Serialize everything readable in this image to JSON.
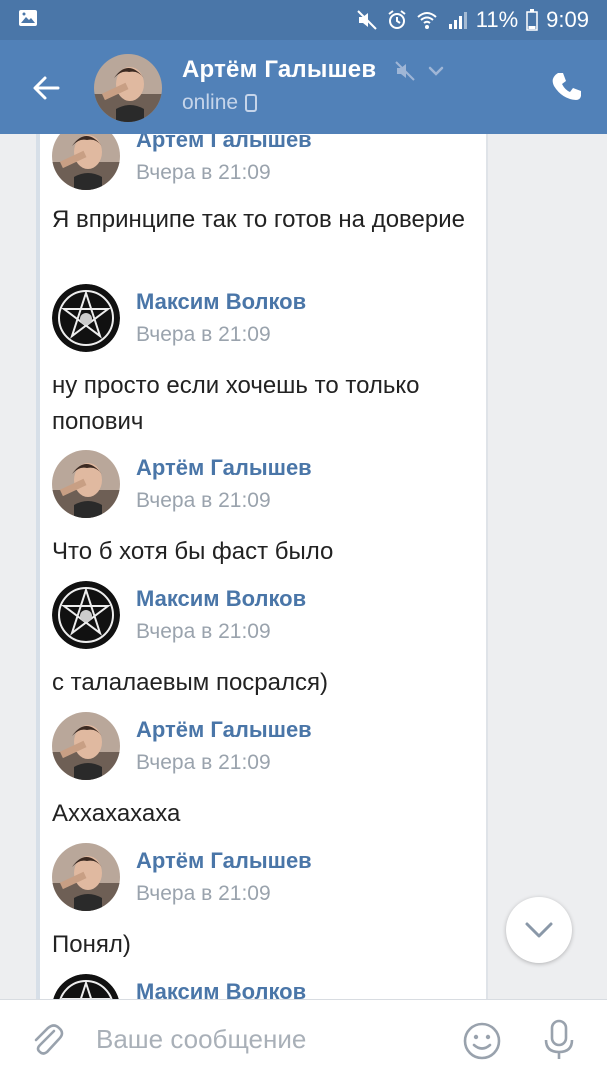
{
  "status_bar": {
    "battery": "11%",
    "time": "9:09"
  },
  "header": {
    "contact_name": "Артём Галышев",
    "status": "online"
  },
  "messages": [
    {
      "author": "Артём Галышев",
      "time": "Вчера в 21:09",
      "text": "Я впринципе так то готов на доверие",
      "avatar": "photo"
    },
    {
      "author": "Максим Волков",
      "time": "Вчера в 21:09",
      "text": "ну просто если хочешь то только попович",
      "avatar": "pentagram"
    },
    {
      "author": "Артём Галышев",
      "time": "Вчера в 21:09",
      "text": "Что б хотя бы фаст было",
      "avatar": "photo"
    },
    {
      "author": "Максим Волков",
      "time": "Вчера в 21:09",
      "text": "с талалаевым посрался)",
      "avatar": "pentagram"
    },
    {
      "author": "Артём Галышев",
      "time": "Вчера в 21:09",
      "text": "Аххахахаха",
      "avatar": "photo"
    },
    {
      "author": "Артём Галышев",
      "time": "Вчера в 21:09",
      "text": "Понял)",
      "avatar": "photo"
    },
    {
      "author": "Максим Волков",
      "time": "",
      "text": "",
      "avatar": "pentagram"
    }
  ],
  "composer": {
    "placeholder": "Ваше сообщение"
  },
  "icons": {
    "back": "arrow-left-icon",
    "mute": "mute-icon",
    "dropdown": "chevron-down-icon",
    "device": "phone-device-icon",
    "call": "phone-call-icon",
    "scroll_down": "chevron-down-icon",
    "attach": "paperclip-icon",
    "emoji": "smiley-icon",
    "mic": "microphone-icon"
  },
  "colors": {
    "header": "#5181b8",
    "status_bar": "#4a76a8",
    "author": "#4a76a8",
    "timestamp": "#9aa3ad",
    "placeholder": "#a9b0b8"
  }
}
